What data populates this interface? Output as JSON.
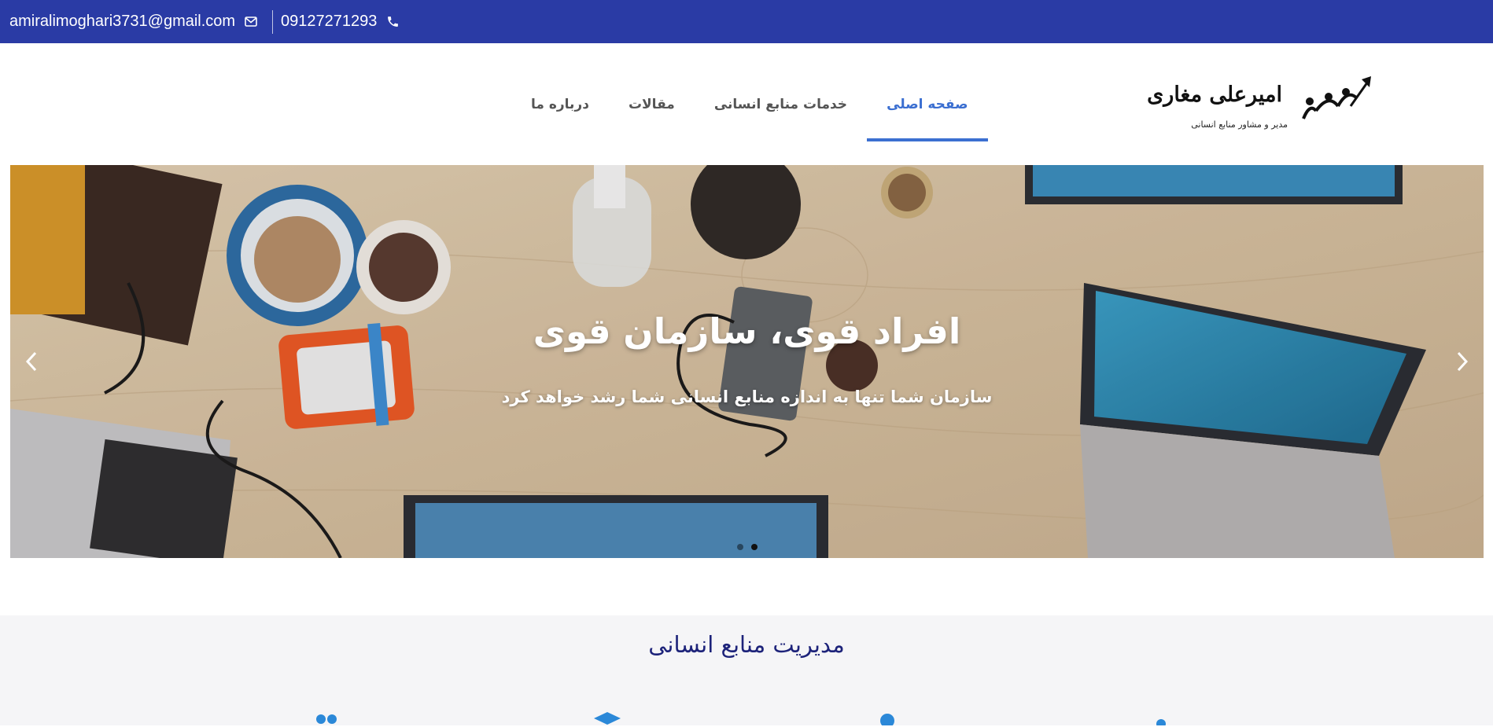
{
  "topbar": {
    "email": "amiralimoghari3731@gmail.com",
    "phone": "09127271293",
    "email_icon": "envelope-icon",
    "phone_icon": "phone-icon"
  },
  "logo": {
    "name": "امیرعلی مغاری",
    "tagline": "مدیر و مشاور منابع انسانی"
  },
  "nav": {
    "items": [
      {
        "label": "صفحه اصلی",
        "active": true
      },
      {
        "label": "خدمات منابع انسانی",
        "active": false
      },
      {
        "label": "مقالات",
        "active": false
      },
      {
        "label": "درباره ما",
        "active": false
      }
    ],
    "accent": "#3b6fd1"
  },
  "hero": {
    "title": "افراد قوی، سازمان قوی",
    "subtitle": "سازمان شما تنها به اندازه منابع انسانی شما رشد خواهد کرد",
    "prev_icon": "chevron-left-icon",
    "next_icon": "chevron-right-icon",
    "slides": 2,
    "active_slide": 2
  },
  "section": {
    "heading": "مدیریت منابع انسانی",
    "heading_color": "#1d237a",
    "icons": [
      "group-icon",
      "graduation-cap-icon",
      "person-icon",
      "person-icon"
    ]
  },
  "colors": {
    "topbar": "#2a3ba5",
    "section_bg": "#f5f5f7"
  }
}
